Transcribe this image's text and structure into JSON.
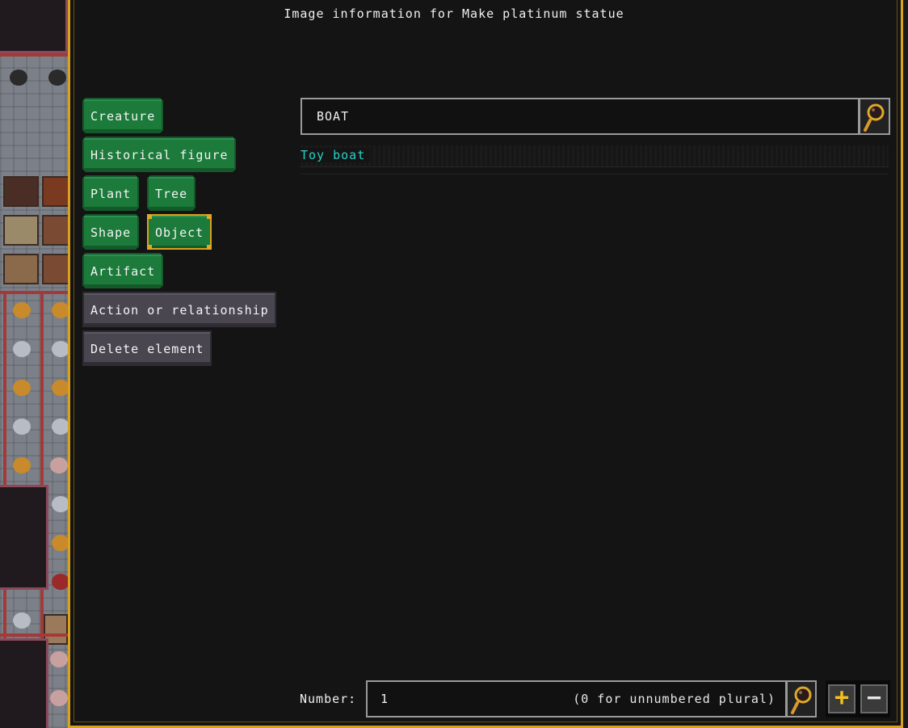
{
  "window": {
    "title": "Image information for Make platinum statue"
  },
  "categories": [
    {
      "label": "Creature",
      "style": "green",
      "selected": false
    },
    {
      "label": "Historical figure",
      "style": "green",
      "selected": false
    },
    {
      "label": "Plant",
      "style": "green",
      "selected": false
    },
    {
      "label": "Tree",
      "style": "green",
      "selected": false
    },
    {
      "label": "Shape",
      "style": "green",
      "selected": false
    },
    {
      "label": "Object",
      "style": "green",
      "selected": true
    },
    {
      "label": "Artifact",
      "style": "green",
      "selected": false
    },
    {
      "label": "Action or relationship",
      "style": "gray",
      "selected": false
    },
    {
      "label": "Delete element",
      "style": "gray",
      "selected": false
    }
  ],
  "search": {
    "value": "BOAT",
    "icon": "magnifier-icon"
  },
  "results": [
    {
      "label": "Toy boat"
    }
  ],
  "number": {
    "label": "Number:",
    "value": "1",
    "hint": "(0 for unnumbered plural)",
    "icon": "magnifier-icon",
    "increment_label": "+",
    "decrement_label": "−"
  },
  "colors": {
    "accent": "#d9a21e",
    "button_green": "#1c7a3a",
    "button_gray": "#4a4650",
    "result_text": "#2ad0c8",
    "background": "#141414"
  }
}
